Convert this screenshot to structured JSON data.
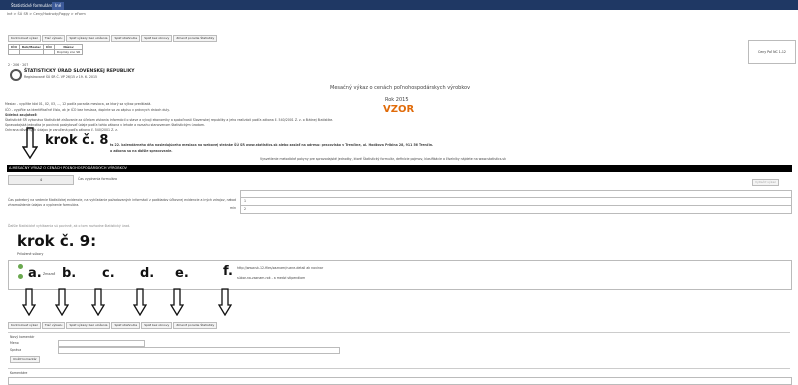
{
  "tabs": [
    "Štatistické formuláre",
    "Iné"
  ],
  "breadcrumb": "Iné > ŠÚ SR > Ceny/Hodnoty/Faggy > eForm",
  "toolbar_top": [
    "Kontrolovať výkaz",
    "Tlač výkazu",
    "Späť výkazy bez uloženia",
    "Späť stiahnutie",
    "Späť bez obnovy",
    "Zmeniť poradie Štatistiky"
  ],
  "org_table": {
    "headers": [
      "IČO",
      "Rok/Mesiac",
      "IČO",
      "Názov"
    ],
    "row": [
      "",
      "",
      "",
      "Doplnky zoo SR"
    ]
  },
  "org_codes": "2 · 206 · 207",
  "office_name": "ŠTATISTICKÝ ÚRAD SLOVENSKEJ REPUBLIKY",
  "office_reg": "Registrované ŠÚ SR Č. VP 26/15 z 19. 6. 2015",
  "right_box": "Ceny Poľ NC 1-12",
  "form_title": "Mesačný výkaz o cenách poľnohospodárskych výrobkov",
  "year": "Rok 2015",
  "stamp": "VZOR",
  "intro_lines": [
    "Mesiac - vyplňte kód 01, 02, 03, ..., 12 podľa poradia mesiaca, za ktorý sa výkaz predkladá.",
    "IČO - vyplňte sa identifikačné číslo, ak je IČO bez hesiaca, doplnte sa zo zápisu v právnych dnioch duly.",
    "Sídelná zaujatosť:",
    "Štatistické SR vykonáva štatistické zisťovanie za účelom získania informácií o stave a vývoji ekonomiky a spoločnosti Slovenskej republiky a jeho realizácii podľa zákona č. 540/2001 Z. z. o štátnej štatistike.",
    "Spravodajská jednotka je povinná poskytovať údaje podľa tohto zákona v lehote a rozsahu stanovenom štatistickým úradom.",
    "Ochrana dôverných údajov je zaručená podľa zákona č. 540/2001 Z. z."
  ],
  "krok8": "krok č. 8",
  "krok8_note": "ts 22. kalendárneho dňa nasledujúceho mesiaca na webovej stránke ŠÚ SR www.statistics.sk alebo zaslať na adresu: pracovisko v Trenčíne, ul. Hodžova Pribina 28, 911 56 Trenčín.",
  "krok8_note2": "a zákona sa na ďalšie spracovanie.",
  "method_note": "Vysvetlenie metodické pokyny pre spravodajské jednotky, ktoré Štatistický formulár, definície pojmov, klasifikácie a číselníky nájdete na www.statistics.sk",
  "section_title": "A.MESAČNÝ VÝKAZ O CENÁCH POĽNOHOSPODÁRSKYCH VÝROBKOV",
  "time_label": "Čas vyplnenia formulára",
  "time_value": "4",
  "right_small_btn": "Vytlačiť výkaz",
  "time_desc": "Čas potrebný na vedenie štatistickej evidencie, na vyhľadanie požadovaných informácií z podkladov účtovnej evidencie a iných zdrojov, na zhromaždenie údajov a vyplnenie formulára.",
  "time_units": [
    "hod",
    "min"
  ],
  "time_rows": [
    "1",
    "2"
  ],
  "footnote": "Ďalšie štatistické vyhlásenia sú povinné, ak o tom rozhodne štatistický úrad.",
  "krok9": "krok č. 9:",
  "attach_label": "Priložené súbory",
  "letters": [
    "a.",
    "b.",
    "c.",
    "d.",
    "e.",
    "f."
  ],
  "file_rows": [
    "http://www.sk-12-files/zaznam/ruzne-detail ak novinar",
    "súbor-na-zaznam-rok - a medzi stipendiom"
  ],
  "delete_label": "Zmazať",
  "toolbar_bottom": [
    "Kontrolovať výkaz",
    "Tlač výkazu",
    "Späť výkazy bez uloženia",
    "Späť stiahnutie",
    "Späť bez obnovy",
    "Zmeniť poradie Štatistiky"
  ],
  "comment_section": "Nový komentár",
  "comment_fields": [
    "Meno",
    "Správa"
  ],
  "comment_button": "Uložiť komentár",
  "comments_label": "Komentáre"
}
